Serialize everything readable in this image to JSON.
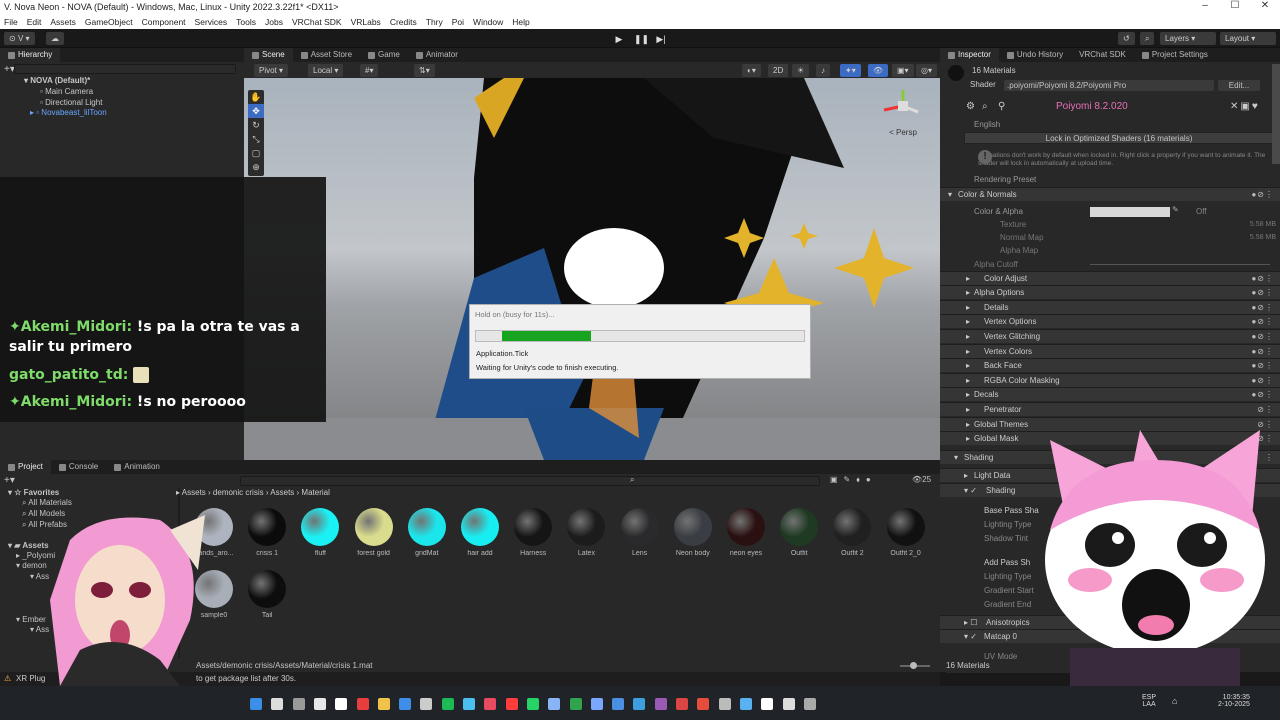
{
  "window": {
    "title": "V. Nova Neon - NOVA (Default) - Windows, Mac, Linux - Unity 2022.3.22f1* <DX11>",
    "controls": [
      "–",
      "☐",
      "✕"
    ]
  },
  "menu": [
    "File",
    "Edit",
    "Assets",
    "GameObject",
    "Component",
    "Services",
    "Tools",
    "Jobs",
    "VRChat SDK",
    "VRLabs",
    "Credits",
    "Thry",
    "Poi",
    "Window",
    "Help"
  ],
  "toolbar": {
    "account": "V",
    "layers": "Layers",
    "layout": "Layout"
  },
  "hierarchy": {
    "tab": "Hierarchy",
    "scene": "NOVA (Default)*",
    "items": [
      "Main Camera",
      "Directional Light",
      "Novabeast_lilToon"
    ]
  },
  "scene_tabs": [
    "Scene",
    "Asset Store",
    "Game",
    "Animator"
  ],
  "scene_tools": {
    "pivot": "Pivot",
    "local": "Local",
    "mode2d": "2D",
    "persp": "< Persp"
  },
  "chat": [
    {
      "user": "Akemi_Midori:",
      "text": " !s pa la otra te vas a salir tu primero",
      "badge": true
    },
    {
      "user": "gato_patito_td:",
      "text": "",
      "badge": false
    },
    {
      "user": "Akemi_Midori:",
      "text": " !s no peroooo",
      "badge": true
    }
  ],
  "dialog": {
    "title": "Hold on (busy for 11s)...",
    "progress": 0.27,
    "line1": "Application.Tick",
    "line2": "Waiting for Unity's code to finish executing."
  },
  "inspector": {
    "tabs": [
      "Inspector",
      "Undo History",
      "VRChat SDK",
      "Project Settings"
    ],
    "materials": "16 Materials",
    "shader_label": "Shader",
    "shader": ".poiyomi/Poiyomi 8.2/Poiyomi Pro",
    "edit": "Edit...",
    "version": "Poiyomi 8.2.020",
    "language": "English",
    "lock_button": "Lock in Optimized Shaders (16 materials)",
    "notice": "Animations don't work by default when locked in. Right click a property if you want to animate it. The shader will lock in automatically at upload time.",
    "rendering_preset": "Rendering Preset",
    "color_normals": "Color & Normals",
    "color_alpha": "Color & Alpha",
    "off": "Off",
    "texture": "Texture",
    "normal_map": "Normal Map",
    "alpha_map": "Alpha Map",
    "size1": "5.58 MB",
    "size2": "5.58 MB",
    "alpha_cutoff": "Alpha Cutoff",
    "sections": [
      "Color Adjust",
      "Alpha Options",
      "Details",
      "Vertex Options",
      "Vertex Glitching",
      "Vertex Colors",
      "Back Face",
      "RGBA Color Masking",
      "Decals",
      "Penetrator",
      "Global Themes",
      "Global Mask"
    ],
    "shading": "Shading",
    "light_data": "Light Data",
    "shading_sub": "Shading",
    "base_pass": "Base Pass Sha",
    "lighting_type": "Lighting Type",
    "shadow_tint": "Shadow Tint",
    "add_pass": "Add Pass Sh",
    "lighting_type2": "Lighting Type",
    "gradient_start": "Gradient Start",
    "gradient_end": "Gradient End",
    "anisotropics": "Anisotropics",
    "matcap": "Matcap 0",
    "uv_mode": "UV Mode",
    "footer": "16 Materials"
  },
  "project": {
    "tabs": [
      "Project",
      "Console",
      "Animation"
    ],
    "favorites": "Favorites",
    "fav_items": [
      "All Materials",
      "All Models",
      "All Prefabs"
    ],
    "assets_root": "Assets",
    "tree": [
      "_Polyomi",
      "demon",
      "Ass",
      "Ember",
      "Ass"
    ],
    "breadcrumb": [
      "Assets",
      "demonic crisis",
      "Assets",
      "Material"
    ],
    "count": "25",
    "assets": [
      {
        "name": "bands_aro...",
        "color": "#aeb4bf"
      },
      {
        "name": "crisis 1",
        "color": "#0b0b0b"
      },
      {
        "name": "fluff",
        "color": "#19f1f4"
      },
      {
        "name": "forest gold",
        "color": "#d9dc8c"
      },
      {
        "name": "gridMat",
        "color": "#1be6ec"
      },
      {
        "name": "hair add",
        "color": "#17eef2"
      },
      {
        "name": "Harness",
        "color": "#151515"
      },
      {
        "name": "Latex",
        "color": "#1c1c1c"
      },
      {
        "name": "Lens",
        "color": "#2a2a2c"
      },
      {
        "name": "Neon body",
        "color": "#3a3e44"
      },
      {
        "name": "neon eyes",
        "color": "#2a1010"
      },
      {
        "name": "Outfit",
        "color": "#1e3a22"
      },
      {
        "name": "Outfit 2",
        "color": "#202020"
      },
      {
        "name": "Outfit 2_0",
        "color": "#111111"
      },
      {
        "name": "sample0",
        "color": "#a8aeb8"
      },
      {
        "name": "Tail",
        "color": "#0d0d0d"
      }
    ],
    "path": "Assets/demonic crisis/Assets/Material/crisis 1.mat"
  },
  "status": {
    "xr": "XR Plug",
    "message": "to get package list after 30s."
  },
  "taskbar": {
    "lang1": "ESP",
    "lang2": "LAA",
    "time": "10:35:35",
    "date": "2-10-2025"
  }
}
